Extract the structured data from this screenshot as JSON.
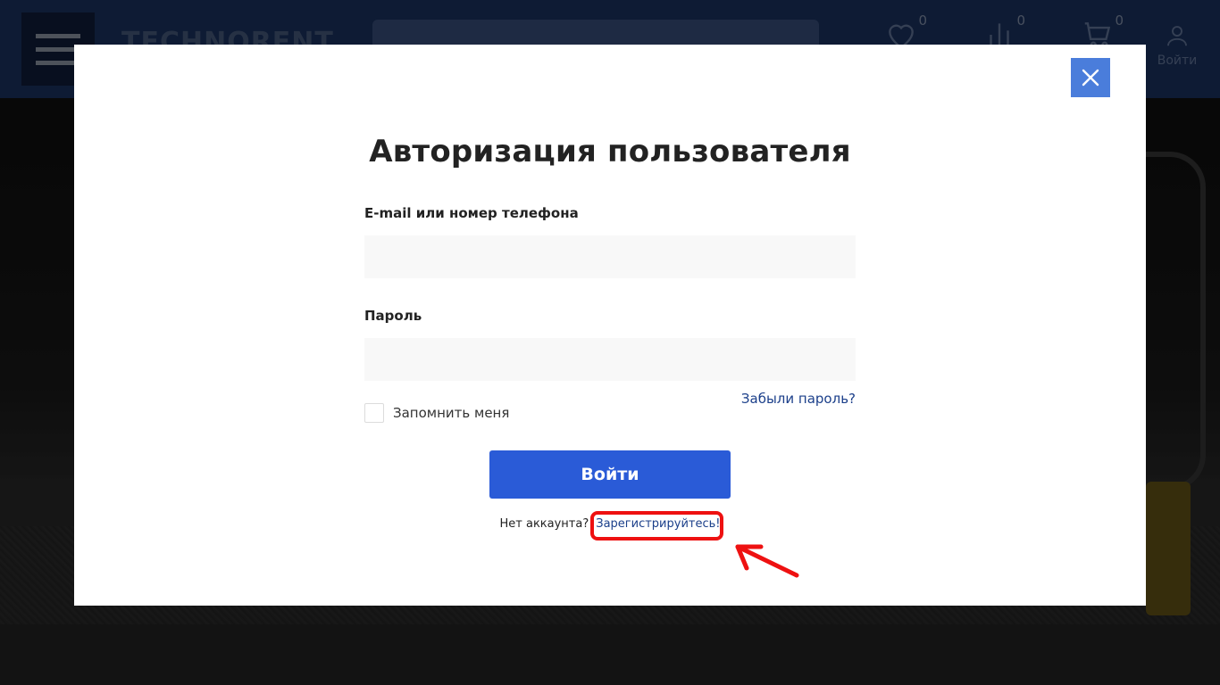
{
  "header": {
    "logo_text": "TECHNORENT",
    "favorites_count": "0",
    "compare_count": "0",
    "cart_count": "0",
    "login_label": "Войти"
  },
  "modal": {
    "title": "Авторизация пользователя",
    "email_label": "E-mail или номер телефона",
    "email_value": "",
    "password_label": "Пароль",
    "password_value": "",
    "forgot_password": "Забыли пароль?",
    "remember_me": "Запомнить меня",
    "submit_label": "Войти",
    "no_account_text": "Нет аккаунта?",
    "register_link": "Зарегистрируйтесь!"
  },
  "colors": {
    "primary_button": "#2a5bd7",
    "close_button": "#4a7ddb",
    "link": "#1b3f8a",
    "annotation_red": "#ee1111"
  },
  "icons": [
    "menu-icon",
    "search-icon",
    "heart-icon",
    "compare-icon",
    "cart-icon",
    "user-icon",
    "close-icon",
    "annotation-arrow-icon"
  ]
}
